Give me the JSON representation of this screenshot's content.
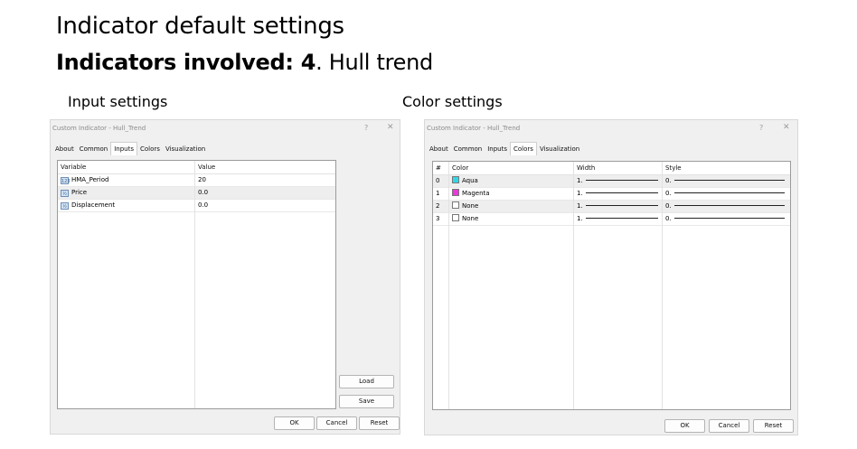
{
  "slide": {
    "title": "Indicator default settings",
    "subtitle_bold": "Indicators involved: 4",
    "subtitle_rest": ". Hull trend",
    "left_caption": "Input settings",
    "right_caption": "Color settings"
  },
  "dialog_left": {
    "title": "Custom Indicator - Hull_Trend",
    "help": "?",
    "close": "✕",
    "tabs": [
      "About",
      "Common",
      "Inputs",
      "Colors",
      "Visualization"
    ],
    "active_tab": "Inputs",
    "columns": [
      "Variable",
      "Value"
    ],
    "rows": [
      {
        "type_icon": "123",
        "name": "HMA_Period",
        "value": "20"
      },
      {
        "type_icon": "½",
        "name": "Price",
        "value": "0.0"
      },
      {
        "type_icon": "½",
        "name": "Displacement",
        "value": "0.0"
      }
    ],
    "load_label": "Load",
    "save_label": "Save",
    "ok_label": "OK",
    "cancel_label": "Cancel",
    "reset_label": "Reset"
  },
  "dialog_right": {
    "title": "Custom Indicator - Hull_Trend",
    "help": "?",
    "close": "✕",
    "tabs": [
      "About",
      "Common",
      "Inputs",
      "Colors",
      "Visualization"
    ],
    "active_tab": "Colors",
    "columns": [
      "#",
      "Color",
      "Width",
      "Style"
    ],
    "rows": [
      {
        "index": "0",
        "color_name": "Aqua",
        "swatch": "#33d6e6",
        "width": "1.",
        "style": "0."
      },
      {
        "index": "1",
        "color_name": "Magenta",
        "swatch": "#e83ad6",
        "width": "1.",
        "style": "0."
      },
      {
        "index": "2",
        "color_name": "None",
        "swatch": "#ffffff",
        "width": "1.",
        "style": "0."
      },
      {
        "index": "3",
        "color_name": "None",
        "swatch": "#ffffff",
        "width": "1.",
        "style": "0."
      }
    ],
    "ok_label": "OK",
    "cancel_label": "Cancel",
    "reset_label": "Reset"
  }
}
